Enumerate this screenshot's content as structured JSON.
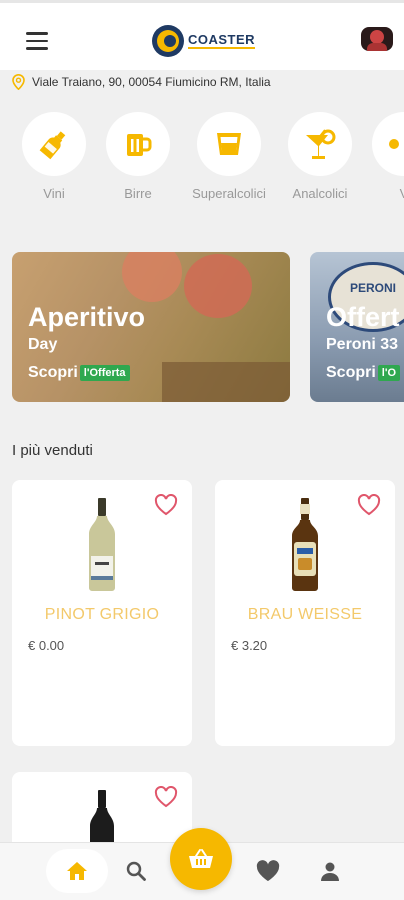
{
  "header": {
    "logo_text": "COASTER"
  },
  "address": "Viale Traiano, 90, 00054 Fiumicino RM, Italia",
  "categories": [
    {
      "label": "Vini",
      "icon": "wine-bottle-icon"
    },
    {
      "label": "Birre",
      "icon": "beer-mug-icon"
    },
    {
      "label": "Superalcolici",
      "icon": "shot-glass-icon"
    },
    {
      "label": "Analcolici",
      "icon": "cocktail-glass-icon"
    },
    {
      "label": "V",
      "icon": "partial-icon"
    }
  ],
  "banners": [
    {
      "title": "Aperitivo",
      "subtitle": "Day",
      "cta": "Scopri",
      "tag": "l'Offerta"
    },
    {
      "title": "Offert",
      "subtitle": "Peroni 33",
      "cta": "Scopri",
      "tag": "l'O",
      "badge_text": "PERONI"
    }
  ],
  "section_title": "I più venduti",
  "products": [
    {
      "name": "PINOT GRIGIO",
      "price": "€ 0.00"
    },
    {
      "name": "BRAU WEISSE",
      "price": "€ 3.20"
    },
    {
      "name": "",
      "price": ""
    }
  ],
  "colors": {
    "accent": "#f6b800",
    "product_name": "#f3c96b",
    "background": "#f0f0f0",
    "heart": "#e0566b",
    "offer_tag": "#2fa84f"
  }
}
